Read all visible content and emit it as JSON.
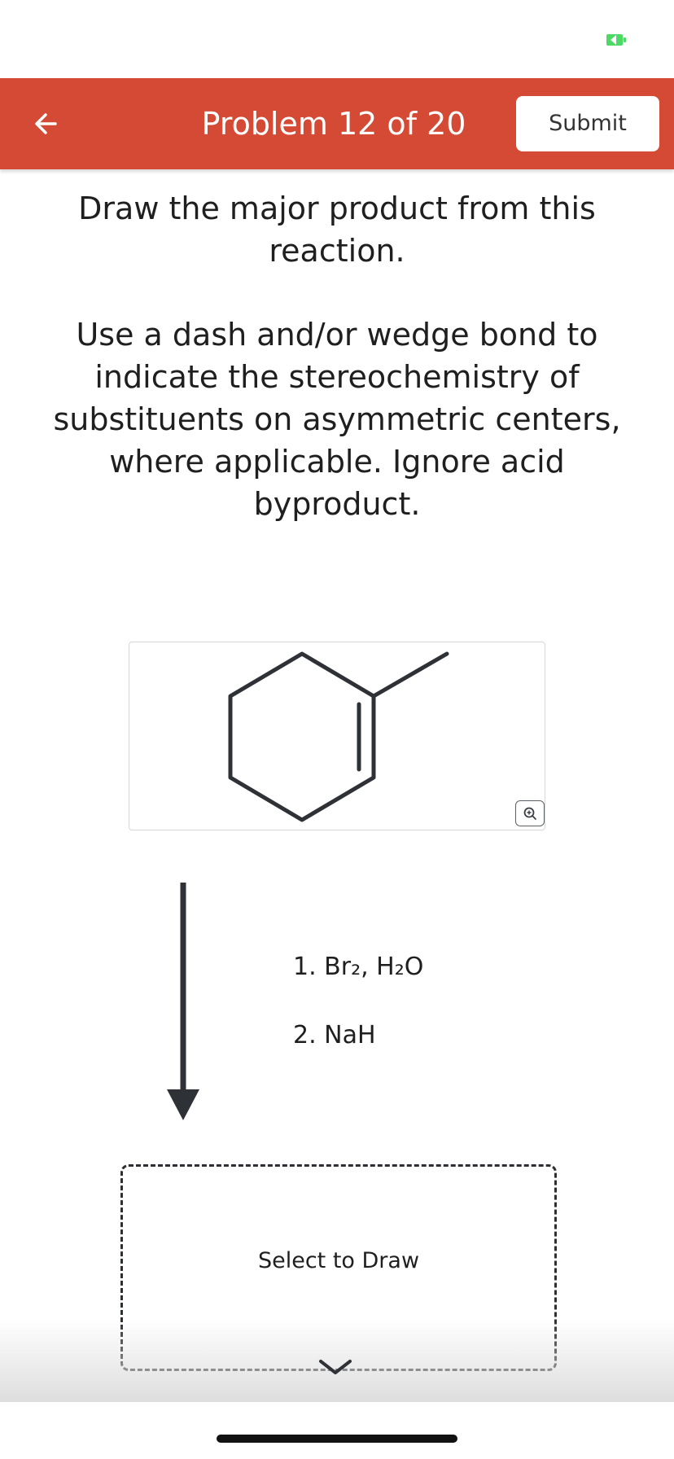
{
  "header": {
    "title": "Problem 12 of 20",
    "submit_label": "Submit",
    "color": "#d44a35"
  },
  "question": {
    "prompt": "Draw the major product from this reaction.",
    "instructions": "Use a dash and/or wedge bond to indicate the stereochemistry of substituents on asymmetric centers, where applicable. Ignore acid byproduct."
  },
  "reaction": {
    "starting_material": "1-methylcyclohexene",
    "reagents": [
      "1. Br₂, H₂O",
      "2. NaH"
    ]
  },
  "answer": {
    "placeholder": "Select to Draw"
  },
  "icons": {
    "back": "back-arrow-icon",
    "zoom": "zoom-in-icon",
    "battery": "battery-icon",
    "expand": "chevron-down-icon"
  }
}
